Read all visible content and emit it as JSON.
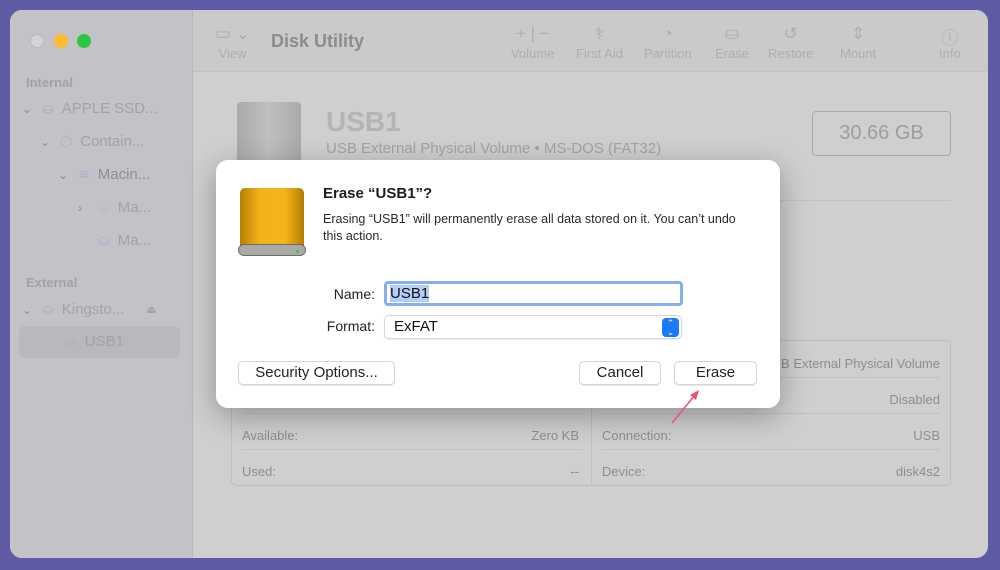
{
  "window": {
    "title": "Disk Utility"
  },
  "sidebar": {
    "sections": [
      {
        "label": "Internal"
      },
      {
        "label": "External"
      }
    ],
    "items": [
      {
        "label": "APPLE SSD..."
      },
      {
        "label": "Contain..."
      },
      {
        "label": "Macin..."
      },
      {
        "label": "Ma..."
      },
      {
        "label": "Ma..."
      },
      {
        "label": "Kingsto..."
      },
      {
        "label": "USB1"
      }
    ]
  },
  "toolbar": {
    "view": "View",
    "volume": "Volume",
    "first_aid": "First Aid",
    "partition": "Partition",
    "erase": "Erase",
    "restore": "Restore",
    "mount": "Mount",
    "info": "Info"
  },
  "volume": {
    "name": "USB1",
    "subtitle": "USB External Physical Volume • MS-DOS (FAT32)",
    "capacity": "30.66 GB"
  },
  "details": {
    "left": [
      {
        "label": "Available:",
        "value": "Zero KB"
      },
      {
        "label": "Used:",
        "value": "--"
      }
    ],
    "right": [
      {
        "label": "",
        "value": "B External Physical Volume"
      },
      {
        "label": "",
        "value": "Disabled"
      },
      {
        "label": "Connection:",
        "value": "USB"
      },
      {
        "label": "Device:",
        "value": "disk4s2"
      }
    ]
  },
  "dialog": {
    "title": "Erase “USB1”?",
    "message": "Erasing “USB1” will permanently erase all data stored on it. You can’t undo this action.",
    "name_label": "Name:",
    "name_value": "USB1",
    "format_label": "Format:",
    "format_value": "ExFAT",
    "security_button": "Security Options...",
    "cancel_button": "Cancel",
    "erase_button": "Erase"
  },
  "colors": {
    "accent": "#1a7cf5",
    "annotation_arrow": "#f0506e"
  }
}
